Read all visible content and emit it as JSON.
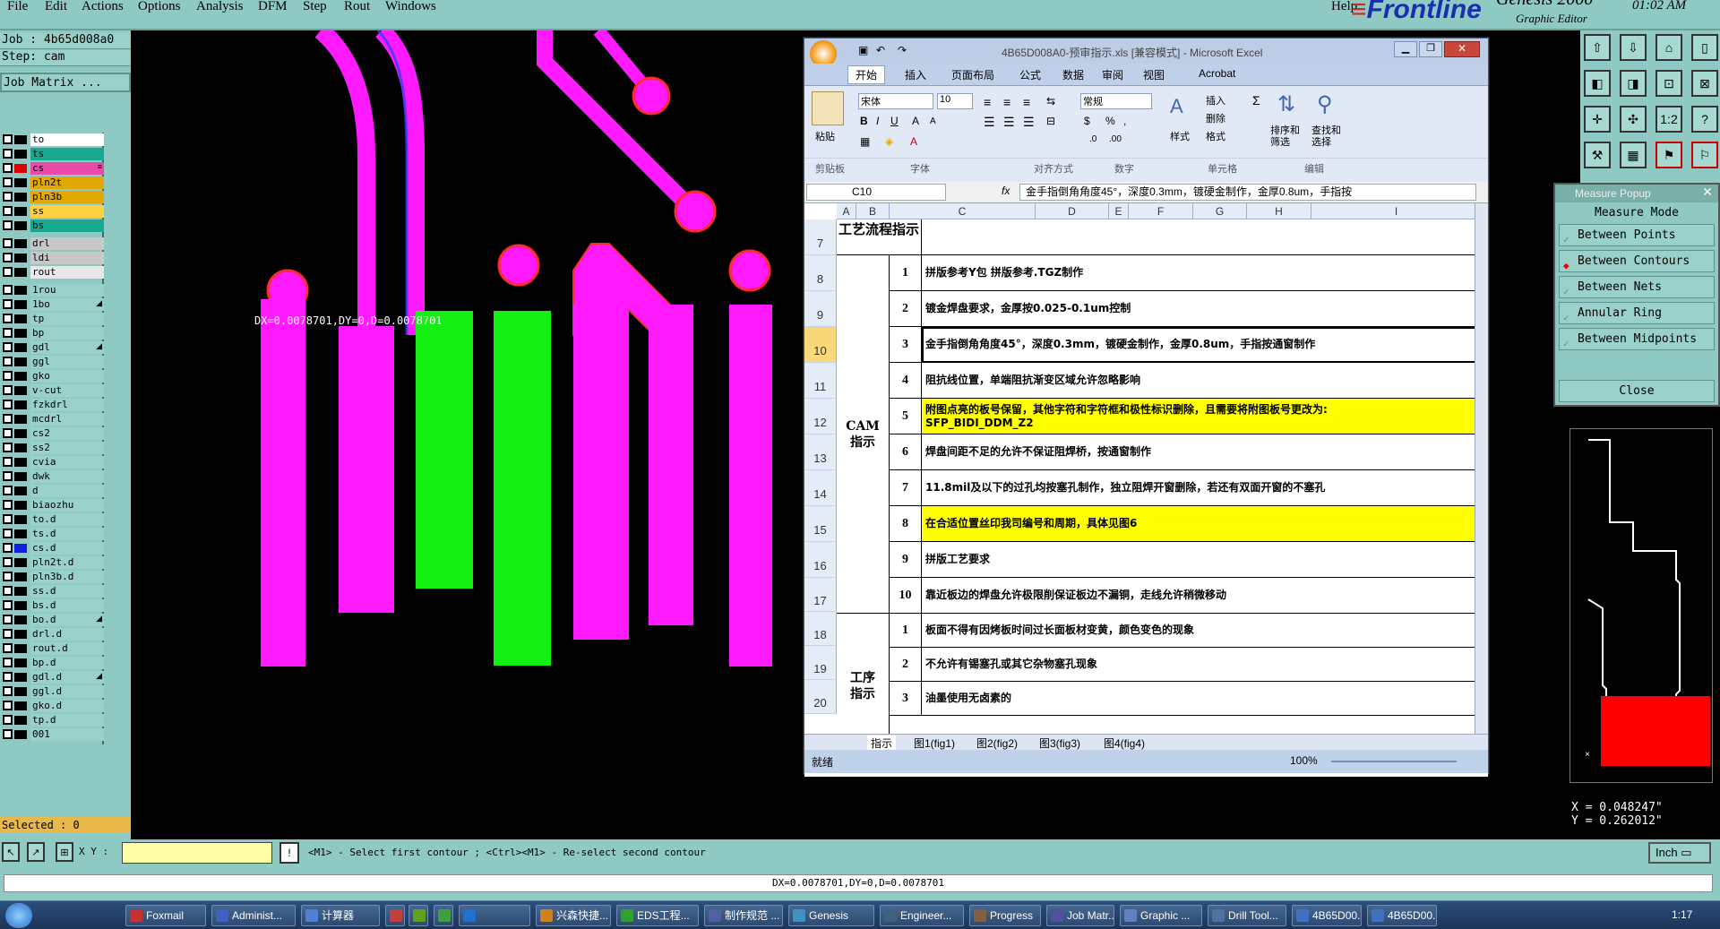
{
  "menu": [
    "File",
    "Edit",
    "Actions",
    "Options",
    "Analysis",
    "DFM",
    "Step",
    "Rout",
    "Windows"
  ],
  "help": "Help",
  "brand": "Frontline",
  "product": "Genesis 2000",
  "product_sub": "Graphic Editor",
  "clock": "01:02 AM",
  "job_line": "Job : 4b65d008a0",
  "step_line": "Step: cam",
  "job_matrix": "Job Matrix ...",
  "layers": [
    {
      "name": "to",
      "color": "#000000",
      "bg": "#ffffff",
      "flag": ""
    },
    {
      "name": "ts",
      "color": "#000000",
      "bg": "#18a890",
      "flag": ""
    },
    {
      "name": "cs",
      "color": "#e00000",
      "bg": "#e84aa8",
      "flag": "≡"
    },
    {
      "name": "pln2t",
      "color": "#000000",
      "bg": "#e0a800",
      "flag": ""
    },
    {
      "name": "pln3b",
      "color": "#000000",
      "bg": "#e0a800",
      "flag": ""
    },
    {
      "name": "ss",
      "color": "#000000",
      "bg": "#ffd040",
      "flag": ""
    },
    {
      "name": "bs",
      "color": "#000000",
      "bg": "#18a890",
      "flag": ""
    },
    {
      "name": "drl",
      "color": "#000000",
      "bg": "#c8c8c8",
      "flag": ""
    },
    {
      "name": "ldi",
      "color": "#000000",
      "bg": "#c8c8c8",
      "flag": ""
    },
    {
      "name": "rout",
      "color": "#000000",
      "bg": "#e8e8e8",
      "flag": ""
    },
    {
      "name": "1rou",
      "color": "#000000",
      "bg": "#9ad0ca",
      "flag": ""
    },
    {
      "name": "1bo",
      "color": "#000000",
      "bg": "#9ad0ca",
      "flag": "◢"
    },
    {
      "name": "tp",
      "color": "#000000",
      "bg": "#9ad0ca",
      "flag": ""
    },
    {
      "name": "bp",
      "color": "#000000",
      "bg": "#9ad0ca",
      "flag": ""
    },
    {
      "name": "gdl",
      "color": "#000000",
      "bg": "#9ad0ca",
      "flag": "◢"
    },
    {
      "name": "ggl",
      "color": "#000000",
      "bg": "#9ad0ca",
      "flag": ""
    },
    {
      "name": "gko",
      "color": "#000000",
      "bg": "#9ad0ca",
      "flag": ""
    },
    {
      "name": "v-cut",
      "color": "#000000",
      "bg": "#9ad0ca",
      "flag": ""
    },
    {
      "name": "fzkdrl",
      "color": "#000000",
      "bg": "#9ad0ca",
      "flag": ""
    },
    {
      "name": "mcdrl",
      "color": "#000000",
      "bg": "#9ad0ca",
      "flag": ""
    },
    {
      "name": "cs2",
      "color": "#000000",
      "bg": "#9ad0ca",
      "flag": ""
    },
    {
      "name": "ss2",
      "color": "#000000",
      "bg": "#9ad0ca",
      "flag": ""
    },
    {
      "name": "cvia",
      "color": "#000000",
      "bg": "#9ad0ca",
      "flag": ""
    },
    {
      "name": "dwk",
      "color": "#000000",
      "bg": "#9ad0ca",
      "flag": ""
    },
    {
      "name": "d",
      "color": "#000000",
      "bg": "#9ad0ca",
      "flag": ""
    },
    {
      "name": "biaozhu",
      "color": "#000000",
      "bg": "#9ad0ca",
      "flag": ""
    },
    {
      "name": "to.d",
      "color": "#000000",
      "bg": "#9ad0ca",
      "flag": ""
    },
    {
      "name": "ts.d",
      "color": "#000000",
      "bg": "#9ad0ca",
      "flag": ""
    },
    {
      "name": "cs.d",
      "color": "#1020e0",
      "bg": "#9ad0ca",
      "flag": ""
    },
    {
      "name": "pln2t.d",
      "color": "#000000",
      "bg": "#9ad0ca",
      "flag": ""
    },
    {
      "name": "pln3b.d",
      "color": "#000000",
      "bg": "#9ad0ca",
      "flag": ""
    },
    {
      "name": "ss.d",
      "color": "#000000",
      "bg": "#9ad0ca",
      "flag": ""
    },
    {
      "name": "bs.d",
      "color": "#000000",
      "bg": "#9ad0ca",
      "flag": ""
    },
    {
      "name": "bo.d",
      "color": "#000000",
      "bg": "#9ad0ca",
      "flag": "◢"
    },
    {
      "name": "drl.d",
      "color": "#000000",
      "bg": "#9ad0ca",
      "flag": ""
    },
    {
      "name": "rout.d",
      "color": "#000000",
      "bg": "#9ad0ca",
      "flag": ""
    },
    {
      "name": "bp.d",
      "color": "#000000",
      "bg": "#9ad0ca",
      "flag": ""
    },
    {
      "name": "gdl.d",
      "color": "#000000",
      "bg": "#9ad0ca",
      "flag": "◢"
    },
    {
      "name": "ggl.d",
      "color": "#000000",
      "bg": "#9ad0ca",
      "flag": ""
    },
    {
      "name": "gko.d",
      "color": "#000000",
      "bg": "#9ad0ca",
      "flag": ""
    },
    {
      "name": "tp.d",
      "color": "#000000",
      "bg": "#9ad0ca",
      "flag": ""
    },
    {
      "name": "001",
      "color": "#000000",
      "bg": "#9ad0ca",
      "flag": ""
    }
  ],
  "selected": "Selected : 0",
  "canvas_measure": "DX=0.0078701,DY=0,D=0.0078701",
  "measure_popup": {
    "title": "Measure Popup",
    "mode": "Measure Mode",
    "options": [
      "Between Points",
      "Between Contours",
      "Between Nets",
      "Annular Ring",
      "Between Midpoints"
    ],
    "active": 1,
    "close": "Close"
  },
  "coords": {
    "x": "X = 0.048247\"",
    "y": "Y = 0.262012\""
  },
  "cmd": {
    "xy_label": "X Y :",
    "prompt": "<M1> - Select first contour ; <Ctrl><M1> - Re-select second contour",
    "units": "Inch"
  },
  "status": "DX=0.0078701,DY=0,D=0.0078701",
  "excel": {
    "title": "4B65D008A0-预审指示.xls [兼容模式] - Microsoft Excel",
    "tabs": [
      "开始",
      "插入",
      "页面布局",
      "公式",
      "数据",
      "审阅",
      "视图",
      "Acrobat"
    ],
    "groups": [
      "剪贴板",
      "字体",
      "对齐方式",
      "数字",
      "单元格",
      "编辑"
    ],
    "paste": "粘贴",
    "font_name": "宋体",
    "font_size": "10",
    "number_format": "常规",
    "style": "样式",
    "insert": "插入",
    "delete": "删除",
    "format": "格式",
    "sort": "排序和\n筛选",
    "find": "查找和\n选择",
    "cell_ref": "C10",
    "formula": "金手指倒角角度45°，深度0.3mm，镀硬金制作，金厚0.8um，手指按",
    "columns": [
      "A",
      "B",
      "C",
      "D",
      "E",
      "F",
      "G",
      "H",
      "I"
    ],
    "row_numbers": [
      "7",
      "8",
      "9",
      "10",
      "11",
      "12",
      "13",
      "14",
      "15",
      "16",
      "17",
      "18",
      "19",
      "20"
    ],
    "header_label": "工艺流程指示",
    "cam_label": "CAM\n指示",
    "proc_label": "工序\n指示",
    "rows": [
      {
        "num": "1",
        "text": "拼版参考Y包 拼版参考.TGZ制作",
        "yellow": false
      },
      {
        "num": "2",
        "text": "镀金焊盘要求，金厚按0.025-0.1um控制",
        "yellow": false
      },
      {
        "num": "3",
        "text": "金手指倒角角度45°，深度0.3mm，镀硬金制作，金厚0.8um，手指按通窗制作",
        "yellow": false
      },
      {
        "num": "4",
        "text": "阻抗线位置，单端阻抗渐变区域允许忽略影响",
        "yellow": false
      },
      {
        "num": "5",
        "text": "附图点亮的板号保留，其他字符和字符框和极性标识删除，且需要将附图板号更改为:\nSFP_BIDI_DDM_Z2",
        "yellow": true
      },
      {
        "num": "6",
        "text": "焊盘间距不足的允许不保证阻焊桥，按通窗制作",
        "yellow": false
      },
      {
        "num": "7",
        "text": "11.8mil及以下的过孔均按塞孔制作，独立阻焊开窗删除，若还有双面开窗的不塞孔",
        "yellow": false
      },
      {
        "num": "8",
        "text": "在合适位置丝印我司编号和周期，具体见图6",
        "yellow": true
      },
      {
        "num": "9",
        "text": "拼版工艺要求",
        "yellow": false
      },
      {
        "num": "10",
        "text": "靠近板边的焊盘允许极限削保证板边不漏铜，走线允许稍微移动",
        "yellow": false
      },
      {
        "num": "1",
        "text": "板面不得有因烤板时间过长面板材变黄，颜色变色的现象",
        "yellow": false
      },
      {
        "num": "2",
        "text": "不允许有锡塞孔或其它杂物塞孔现象",
        "yellow": false
      },
      {
        "num": "3",
        "text": "油墨使用无卤素的",
        "yellow": false
      }
    ],
    "sheet_tabs": [
      "指示",
      "图1(fig1)",
      "图2(fig2)",
      "图3(fig3)",
      "图4(fig4)"
    ],
    "ready": "就绪",
    "zoom": "100%"
  },
  "taskbar": {
    "items": [
      "Foxmail",
      "Administ...",
      "计算器",
      "",
      "",
      "",
      "",
      "兴森快捷...",
      "EDS工程...",
      "制作规范 ...",
      "Genesis",
      "Engineer...",
      "Progress",
      "Job Matr...",
      "Graphic ...",
      "Drill Tool...",
      "4B65D00...",
      "4B65D00..."
    ],
    "time": "1:17"
  }
}
